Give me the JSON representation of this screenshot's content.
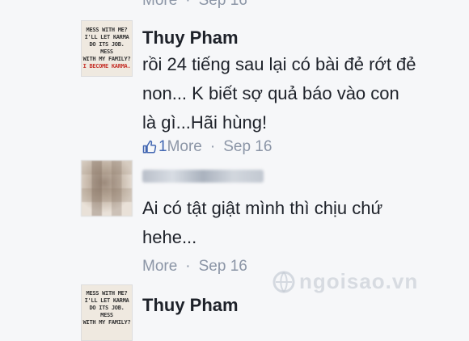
{
  "top_meta": {
    "more": "More",
    "date": "Sep 16",
    "dot": "·"
  },
  "comment1": {
    "avatar_lines": [
      "MESS WITH ME?",
      "I'LL LET KARMA",
      "DO ITS JOB. MESS",
      "WITH MY FAMILY?",
      "I BECOME KARMA."
    ],
    "author": "Thuy Pham",
    "lines": [
      "rồi 24 tiếng sau lại có bài đẻ rớt đẻ",
      "non... K biết sợ quả báo vào con",
      "là gì...Hãi hùng!"
    ],
    "like_count": "1",
    "more": "More",
    "dot": "·",
    "date": "Sep 16"
  },
  "comment2": {
    "lines": [
      "Ai có tật giật mình thì chịu chứ",
      "hehe..."
    ],
    "more": "More",
    "dot": "·",
    "date": "Sep 16"
  },
  "comment3": {
    "avatar_lines": [
      "MESS WITH ME?",
      "I'LL LET KARMA",
      "DO ITS JOB. MESS",
      "WITH MY FAMILY?"
    ],
    "author": "Thuy Pham"
  },
  "watermark": {
    "text": "ngoisao.vn"
  },
  "icons": {
    "like": "thumbs-up-icon",
    "watermark": "globe-logo"
  },
  "colors": {
    "link": "#4267b2",
    "meta": "#8b95a6",
    "background": "#f6f7f9"
  }
}
